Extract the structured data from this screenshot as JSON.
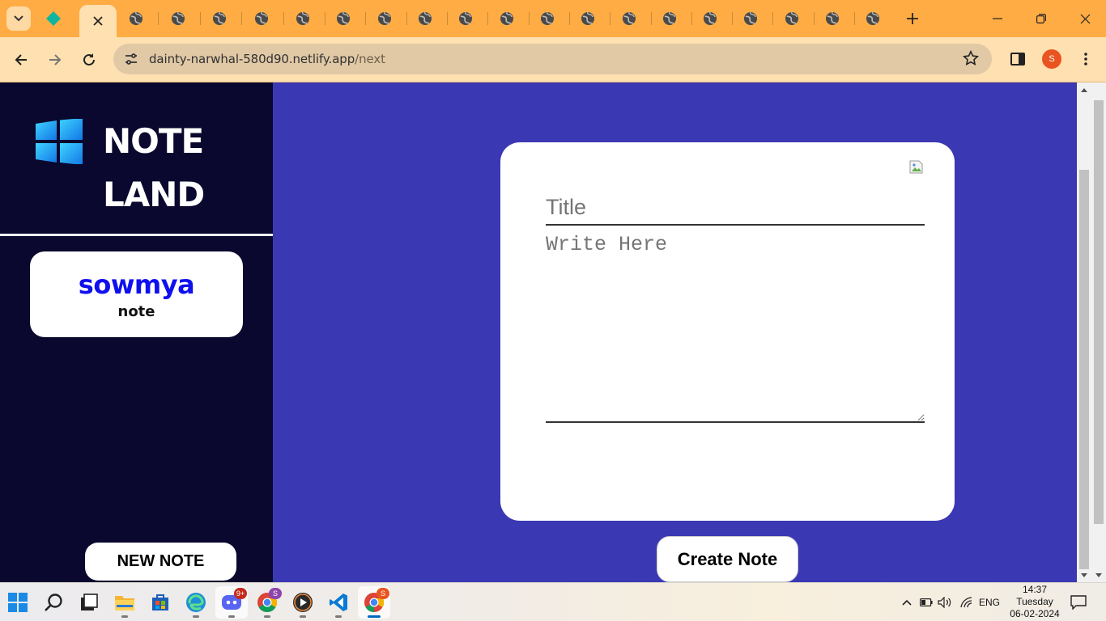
{
  "browser": {
    "url_host": "dainty-narwhal-580d90.netlify.app",
    "url_path": "/next",
    "profile_initial": "S",
    "theme_color": "#ffac44"
  },
  "app": {
    "brand_line1": "NOTE",
    "brand_line2": "LAND",
    "notes": [
      {
        "title": "sowmya",
        "subtitle": "note"
      }
    ],
    "new_note_label": "NEW NOTE",
    "title_placeholder": "Title",
    "body_placeholder": "Write Here",
    "create_label": "Create Note",
    "sidebar_color": "#0a082e",
    "main_color": "#3b38b4"
  },
  "taskbar": {
    "discord_badge": "9+",
    "chrome_badge": "S",
    "chrome2_badge": "S",
    "language": "ENG",
    "time": "14:37",
    "day": "Tuesday",
    "date": "06-02-2024"
  }
}
